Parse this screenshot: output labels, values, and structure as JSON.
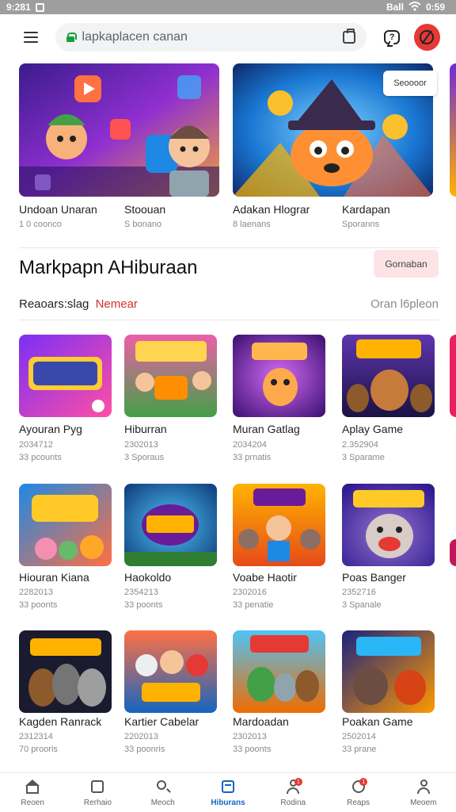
{
  "status_bar": {
    "time": "9:281",
    "right": "Ball",
    "right_time": "0:59"
  },
  "topbar": {
    "search_text": "lapkaplacen canan"
  },
  "featured": [
    {
      "title": "Undoan Unaran",
      "sub": "1 0 coonco"
    },
    {
      "title": "Stoouan",
      "sub": "S bonano"
    },
    {
      "title": "Adakan Hlograr",
      "sub": "8 laenans"
    },
    {
      "title": "Kardapan",
      "sub": "Sporanns"
    }
  ],
  "featured_badge": "Seoooor",
  "section": {
    "title": "Markpapn AHiburaan",
    "button": "Gornaban",
    "filter_label": "Reaoars:slag",
    "filter_new": "Nemear",
    "filter_right": "Oran l6pleon"
  },
  "games": [
    {
      "name": "Ayouran Pyg",
      "meta1": "2034712",
      "meta2": "33 pcounts"
    },
    {
      "name": "Hiburran",
      "meta1": "2302013",
      "meta2": "3 Sporaus"
    },
    {
      "name": "Muran Gatlag",
      "meta1": "2034204",
      "meta2": "33 prnatis"
    },
    {
      "name": "Aplay Game",
      "meta1": "2.352904",
      "meta2": "3 Sparame"
    },
    {
      "name": "Hiouran Kiana",
      "meta1": "2282013",
      "meta2": "33 poonts"
    },
    {
      "name": "Haokoldo",
      "meta1": "2354213",
      "meta2": "33 poonts"
    },
    {
      "name": "Voabe Haotir",
      "meta1": "2302016",
      "meta2": "33 penatie"
    },
    {
      "name": "Poas Banger",
      "meta1": "2352716",
      "meta2": "3 Spanale"
    },
    {
      "name": "Kagden Ranrack",
      "meta1": "2312314",
      "meta2": "70 prooris"
    },
    {
      "name": "Kartier Cabelar",
      "meta1": "2202013",
      "meta2": "33 poonris"
    },
    {
      "name": "Mardoadan",
      "meta1": "2302013",
      "meta2": "33 poonts"
    },
    {
      "name": "Poakan Game",
      "meta1": "2502014",
      "meta2": "33 prane"
    }
  ],
  "nav": [
    {
      "label": "Reoen"
    },
    {
      "label": "Rerhaio"
    },
    {
      "label": "Meoch"
    },
    {
      "label": "Hiburans"
    },
    {
      "label": "Rodina",
      "badge": "1"
    },
    {
      "label": "Reaps",
      "badge": "1"
    },
    {
      "label": "Meoem"
    }
  ],
  "colors": {
    "accent": "#1565c0",
    "badge": "#e53935",
    "avatar": "#e53935"
  }
}
